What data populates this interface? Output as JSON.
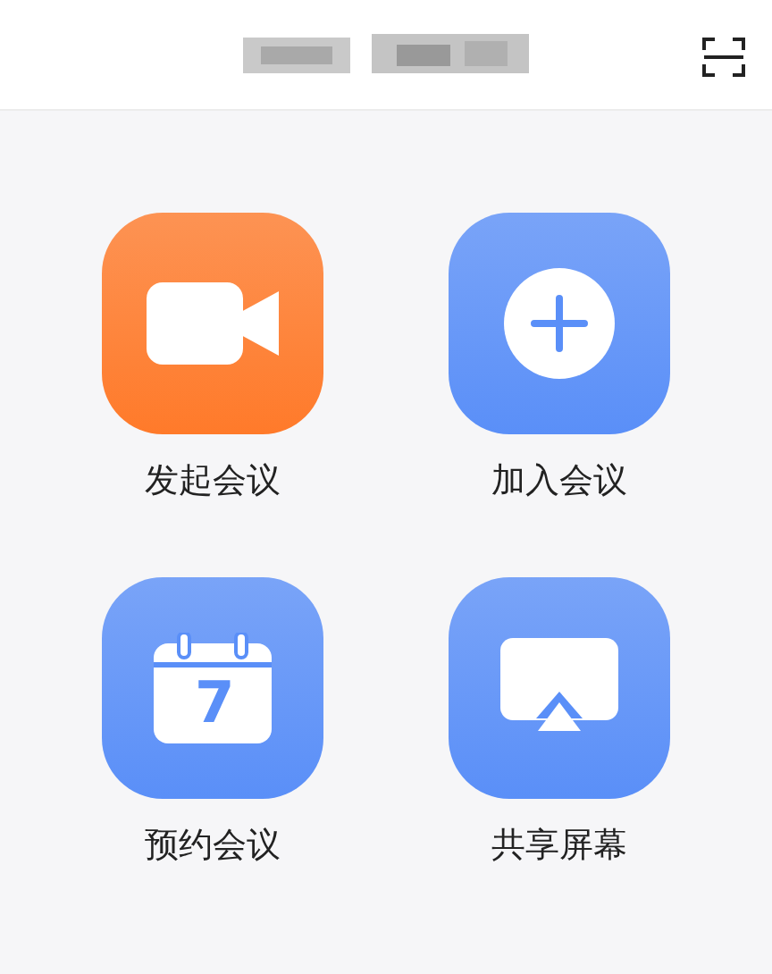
{
  "header": {
    "title_obscured": true
  },
  "actions": [
    {
      "kind": "video",
      "label": "发起会议",
      "color": "#ff7a2a"
    },
    {
      "kind": "plus",
      "label": "加入会议",
      "color": "#5a8ff8"
    },
    {
      "kind": "calendar",
      "label": "预约会议",
      "color": "#5a8ff8",
      "day": "7"
    },
    {
      "kind": "screen",
      "label": "共享屏幕",
      "color": "#5a8ff8"
    }
  ]
}
